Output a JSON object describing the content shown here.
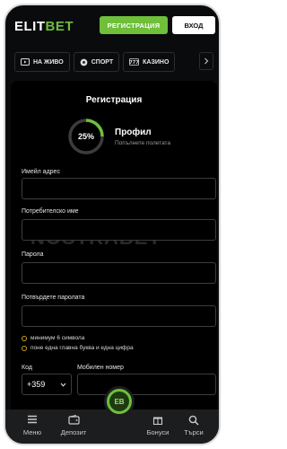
{
  "header": {
    "logo_main": "ELIT",
    "logo_accent": "BET",
    "register_label": "РЕГИСТРАЦИЯ",
    "login_label": "ВХОД"
  },
  "nav": {
    "items": [
      {
        "label": "НА ЖИВО",
        "icon": "live-tv-icon"
      },
      {
        "label": "СПОРТ",
        "icon": "soccer-ball-icon"
      },
      {
        "label": "КАЗИНО",
        "icon": "slot-777-icon"
      }
    ],
    "more_icon": "chevron-right-icon"
  },
  "form": {
    "title": "Регистрация",
    "progress_percent": 25,
    "progress_label": "25%",
    "profile_title": "Профил",
    "profile_subtitle": "Попълнете полетата",
    "email_label": "Имейл адрес",
    "username_label": "Потребителско име",
    "password_label": "Парола",
    "confirm_password_label": "Потвърдете паролата",
    "hints": [
      "минимум 6 символа",
      "поне една главна буква и една цифра"
    ],
    "code_label": "Код",
    "code_value": "+359",
    "mobile_label": "Мобилен номер"
  },
  "watermark": "NOSTRABET",
  "bottom_nav": {
    "items": [
      {
        "label": "Меню",
        "icon": "menu-icon"
      },
      {
        "label": "Депозит",
        "icon": "wallet-icon"
      },
      {
        "label": "Бонуси",
        "icon": "gift-icon"
      },
      {
        "label": "Търси",
        "icon": "search-icon"
      }
    ],
    "fab_label": "EB"
  },
  "colors": {
    "accent": "#6fbf3a",
    "background": "#0a0b0c",
    "hint_dot": "#c9a227"
  }
}
